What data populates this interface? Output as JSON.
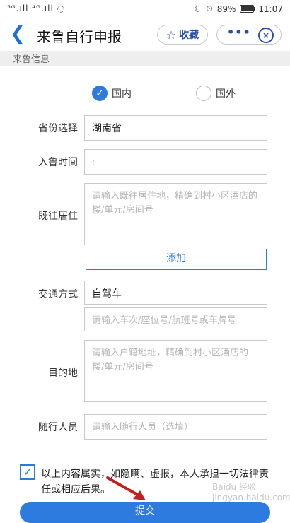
{
  "status": {
    "left": "⁵ᴳ.ıll ⁴ᴳ.ıll ◌",
    "right_icons": [
      "moon",
      "alarm"
    ],
    "battery": "89%",
    "battery_level": 0.89,
    "time": "11:07"
  },
  "nav": {
    "back_icon": "back-arrow-icon",
    "title": "来鲁自行申报",
    "fav_label": "收藏",
    "more_label": "•••"
  },
  "section": {
    "title": "来鲁信息"
  },
  "form": {
    "origin": {
      "domestic": "国内",
      "foreign": "国外",
      "selected": "domestic"
    },
    "province": {
      "label": "省份选择",
      "value": "湖南省"
    },
    "entry_time": {
      "label": "入鲁时间",
      "value": ":"
    },
    "previous": {
      "label": "既往居住",
      "placeholder": "请输入既往居住地，精确到村小区酒店的楼/单元/房间号",
      "add_label": "添加"
    },
    "transport": {
      "label": "交通方式",
      "value": "自驾车",
      "placeholder": "请输入车次/座位号/航班号或车牌号"
    },
    "destination": {
      "label": "目的地",
      "placeholder": "请输入户籍地址，精确到村小区酒店的楼/单元/房间号"
    },
    "companions": {
      "label": "随行人员",
      "placeholder": "请输入随行人员（选填）"
    }
  },
  "agree": {
    "text": "以上内容属实，如隐瞒、虚报，本人承担一切法律责任或相应后果。",
    "checked": true
  },
  "submit_label": "提交",
  "watermark": "Baidu 经验 jingyan.baidu.com",
  "colors": {
    "accent": "#2e7be0",
    "nav_blue": "#2b4fa8"
  }
}
